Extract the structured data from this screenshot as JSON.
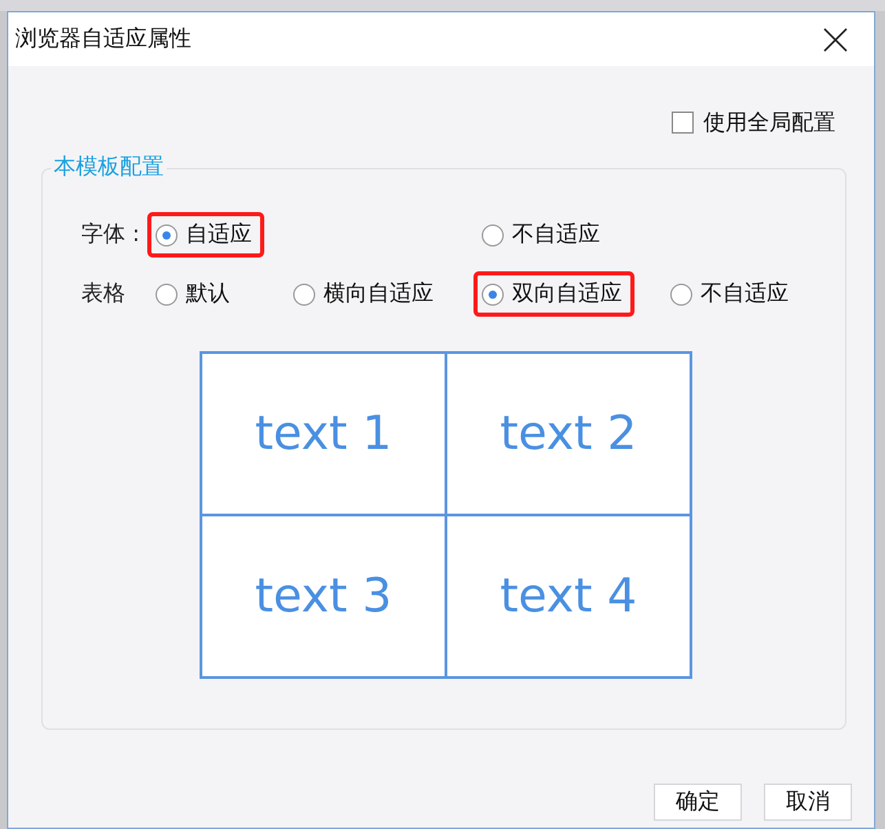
{
  "window": {
    "title": "浏览器自适应属性"
  },
  "use_global": {
    "label": "使用全局配置",
    "checked": false
  },
  "group": {
    "title": "本模板配置",
    "rows": [
      {
        "label": "字体 :",
        "options": [
          {
            "label": "自适应",
            "selected": true,
            "highlighted": true
          },
          {
            "label": "不自适应",
            "selected": false,
            "highlighted": false
          }
        ]
      },
      {
        "label": "表格",
        "options": [
          {
            "label": "默认",
            "selected": false,
            "highlighted": false
          },
          {
            "label": "横向自适应",
            "selected": false,
            "highlighted": false
          },
          {
            "label": "双向自适应",
            "selected": true,
            "highlighted": true
          },
          {
            "label": "不自适应",
            "selected": false,
            "highlighted": false
          }
        ]
      }
    ],
    "preview": [
      "text 1",
      "text 2",
      "text 3",
      "text 4"
    ]
  },
  "buttons": [
    "确定",
    "取消"
  ]
}
